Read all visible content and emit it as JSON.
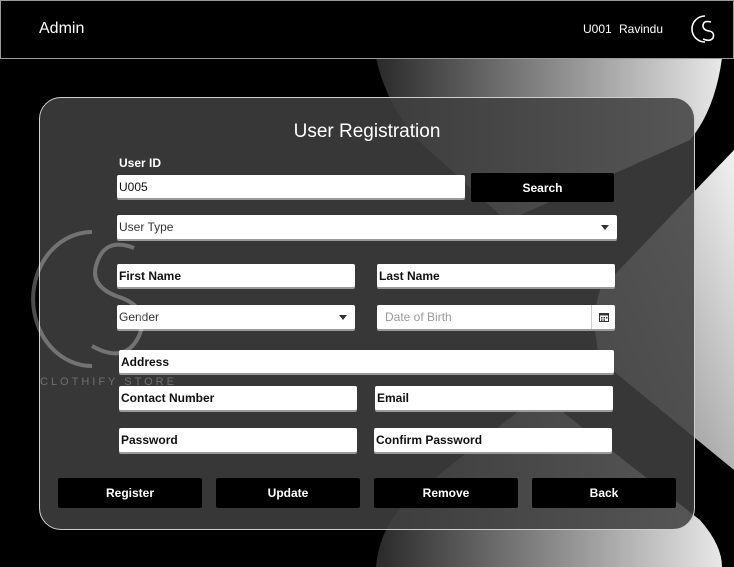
{
  "header": {
    "title": "Admin",
    "user_id": "U001",
    "user_name": "Ravindu"
  },
  "form": {
    "title": "User Registration",
    "user_id_label": "User ID",
    "user_id_value": "U005",
    "search_label": "Search",
    "user_type_placeholder": "User Type",
    "first_name": "First Name",
    "last_name": "Last Name",
    "gender_placeholder": "Gender",
    "dob_placeholder": "Date of Birth",
    "address": "Address",
    "contact_number": "Contact Number",
    "email": "Email",
    "password": "Password",
    "confirm_password": "Confirm Password"
  },
  "actions": {
    "register": "Register",
    "update": "Update",
    "remove": "Remove",
    "back": "Back"
  },
  "watermark": {
    "text": "CLOTHIFY STORE"
  },
  "colors": {
    "background": "#000000",
    "panel": "#404040",
    "button": "#000000",
    "text": "#ffffff"
  }
}
